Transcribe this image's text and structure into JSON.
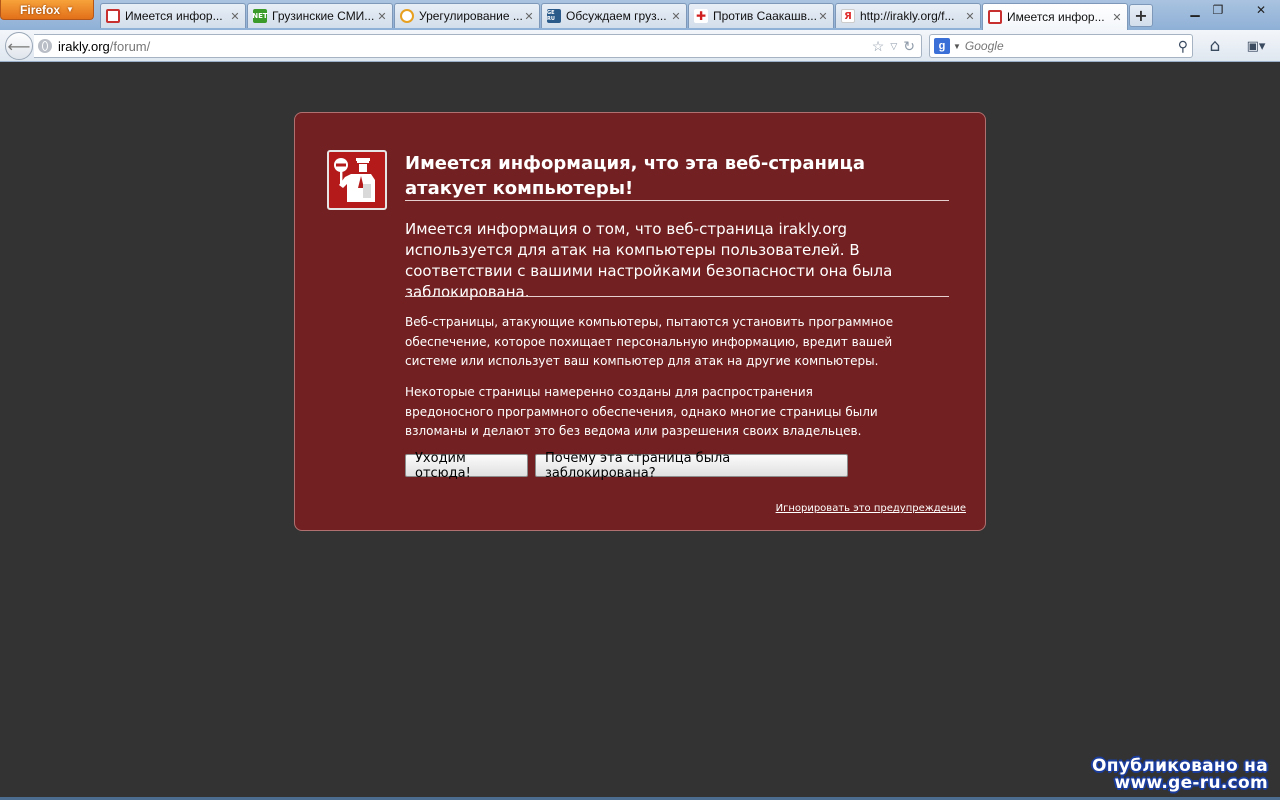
{
  "browser": {
    "menu_button": "Firefox",
    "tabs": [
      {
        "title": "Имеется инфор...",
        "fav_color": "#c83030"
      },
      {
        "title": "Грузинские СМИ...",
        "fav_color": "#3a9a2a",
        "fav_text": "NET"
      },
      {
        "title": "Урегулирование ...",
        "fav_color": "#e8a020"
      },
      {
        "title": "Обсуждаем груз...",
        "fav_color": "#2a5a8a",
        "fav_text": "GE RU"
      },
      {
        "title": "Против Саакашв...",
        "fav_color": "#d02020"
      },
      {
        "title": "http://irakly.org/f...",
        "fav_color": "#e03030",
        "fav_text": "Я"
      },
      {
        "title": "Имеется инфор...",
        "fav_color": "#c83030",
        "active": true
      }
    ],
    "url_host": "irakly.org",
    "url_path": "/forum/",
    "search_placeholder": "Google"
  },
  "error": {
    "title": "Имеется информация, что эта веб-страница атакует компьютеры!",
    "short_desc": "Имеется информация о том, что веб-страница irakly.org используется для атак на компьютеры пользователей. В соответствии с вашими настройками безопасности она была заблокирована.",
    "long_desc_1": "Веб-страницы, атакующие компьютеры, пытаются установить программное обеспечение, которое похищает персональную информацию, вредит вашей системе или использует ваш компьютер для атак на другие компьютеры.",
    "long_desc_2": "Некоторые страницы намеренно созданы для распространения вредоносного программного обеспечения, однако многие страницы были взломаны и делают это без ведома или разрешения своих владельцев.",
    "get_me_out_button": "Уходим отсюда!",
    "why_blocked_button": "Почему эта страница была заблокирована?",
    "ignore_link": "Игнорировать это предупреждение"
  },
  "watermark": {
    "line1": "Опубликовано на",
    "line2": "www.ge-ru.com"
  },
  "colors": {
    "error_background": "#722021",
    "page_background": "#333333",
    "firefox_button": "#e2701a"
  }
}
